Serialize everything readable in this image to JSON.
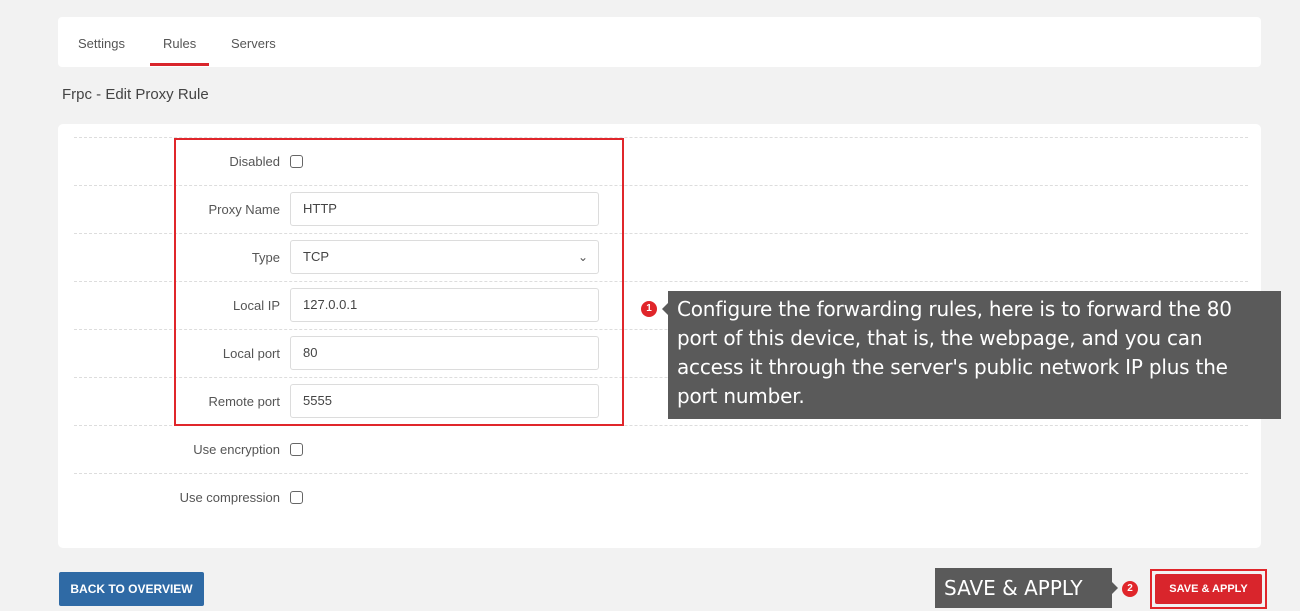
{
  "tabs": [
    {
      "label": "Settings"
    },
    {
      "label": "Rules",
      "active": true
    },
    {
      "label": "Servers"
    }
  ],
  "page_title": "Frpc - Edit Proxy Rule",
  "form": {
    "disabled_label": "Disabled",
    "proxy_name_label": "Proxy Name",
    "proxy_name_value": "HTTP",
    "type_label": "Type",
    "type_value": "TCP",
    "local_ip_label": "Local IP",
    "local_ip_value": "127.0.0.1",
    "local_port_label": "Local port",
    "local_port_value": "80",
    "remote_port_label": "Remote port",
    "remote_port_value": "5555",
    "use_encryption_label": "Use encryption",
    "use_compression_label": "Use compression"
  },
  "annotations": {
    "badge1": "1",
    "note1": "Configure the forwarding rules, here is to forward the 80 port of this device, that is, the webpage, and you can access it through the server's public network IP plus the port number.",
    "badge2": "2",
    "note2": "SAVE & APPLY"
  },
  "buttons": {
    "back_label": "BACK TO OVERVIEW",
    "save_label": "SAVE & APPLY"
  },
  "colors": {
    "accent_red": "#d9252c",
    "back_button_blue": "#2f6aa5",
    "callout_gray": "#5a5a5a"
  }
}
